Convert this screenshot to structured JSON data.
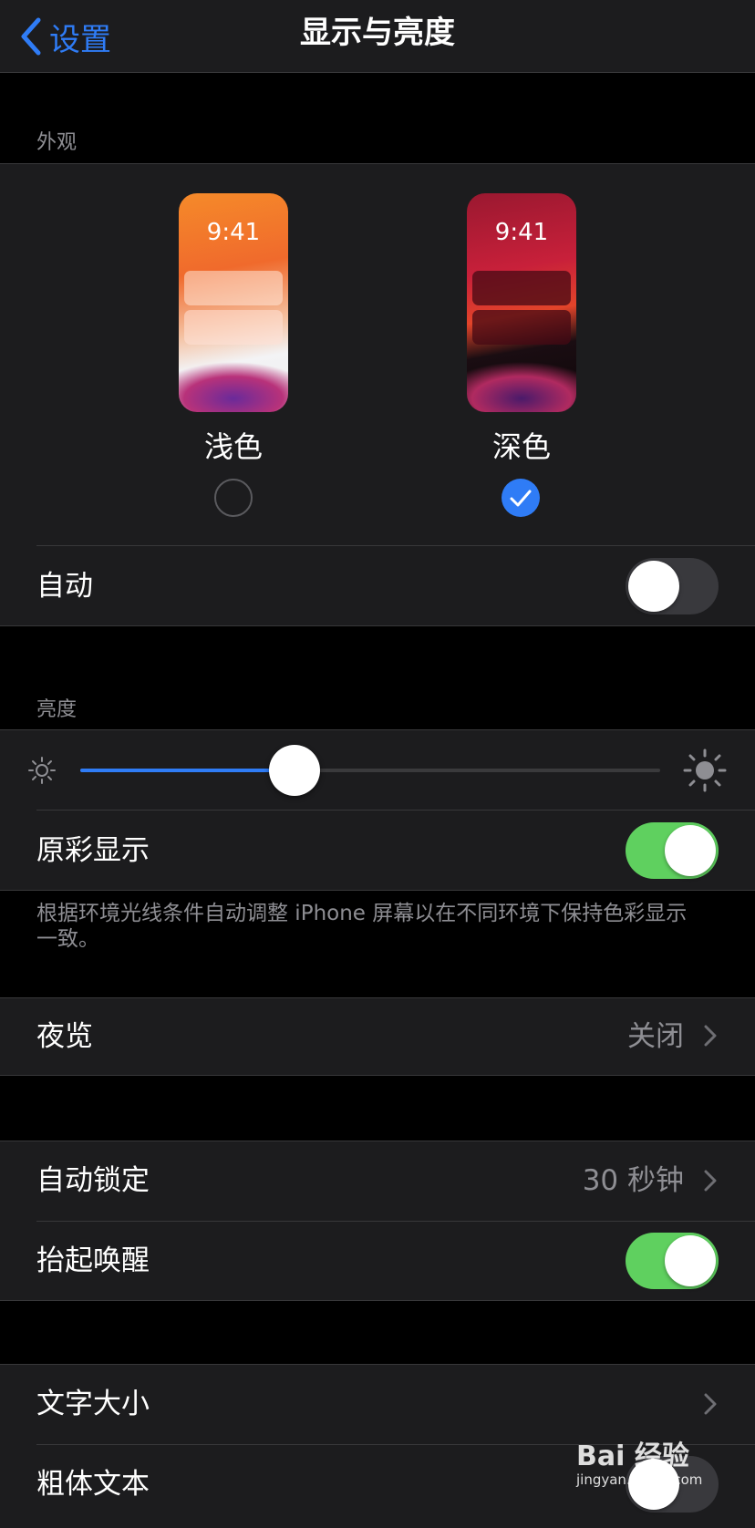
{
  "nav": {
    "back_label": "设置",
    "title": "显示与亮度"
  },
  "appearance": {
    "header": "外观",
    "preview_time": "9:41",
    "light": {
      "label": "浅色",
      "selected": false
    },
    "dark": {
      "label": "深色",
      "selected": true
    },
    "auto": {
      "label": "自动",
      "on": false
    }
  },
  "brightness": {
    "header": "亮度",
    "level": 0.37,
    "true_tone": {
      "label": "原彩显示",
      "on": true
    },
    "description": "根据环境光线条件自动调整 iPhone 屏幕以在不同环境下保持色彩显示一致。"
  },
  "night_shift": {
    "label": "夜览",
    "value": "关闭"
  },
  "auto_lock": {
    "label": "自动锁定",
    "value": "30 秒钟"
  },
  "raise_to_wake": {
    "label": "抬起唤醒",
    "on": true
  },
  "text_size": {
    "label": "文字大小"
  },
  "bold_text": {
    "label": "粗体文本",
    "on": false
  },
  "watermark": {
    "logo": "Bai 经验",
    "sub": "jingyan.baidu.com"
  },
  "colors": {
    "accent": "#2f7cf6",
    "toggle_on": "#5fd05f",
    "background": "#000000",
    "cell": "#1c1c1e",
    "secondary_text": "#8e8e93"
  }
}
